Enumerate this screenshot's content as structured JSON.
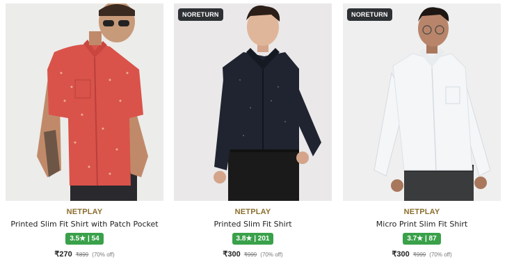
{
  "products": [
    {
      "badge": "",
      "brand": "NETPLAY",
      "title": "Printed Slim Fit Shirt with Patch Pocket",
      "rating": "3.5★ | 54",
      "price": "₹270",
      "mrp": "₹899",
      "discount": "(70% off)",
      "shirt_color": "#d9534a"
    },
    {
      "badge": "NORETURN",
      "brand": "NETPLAY",
      "title": "Printed Slim Fit Shirt",
      "rating": "3.8★ | 201",
      "price": "₹300",
      "mrp": "₹999",
      "discount": "(70% off)",
      "shirt_color": "#1f2430"
    },
    {
      "badge": "NORETURN",
      "brand": "NETPLAY",
      "title": "Micro Print Slim Fit Shirt",
      "rating": "3.7★ | 87",
      "price": "₹300",
      "mrp": "₹999",
      "discount": "(70% off)",
      "shirt_color": "#f4f6f8"
    }
  ]
}
